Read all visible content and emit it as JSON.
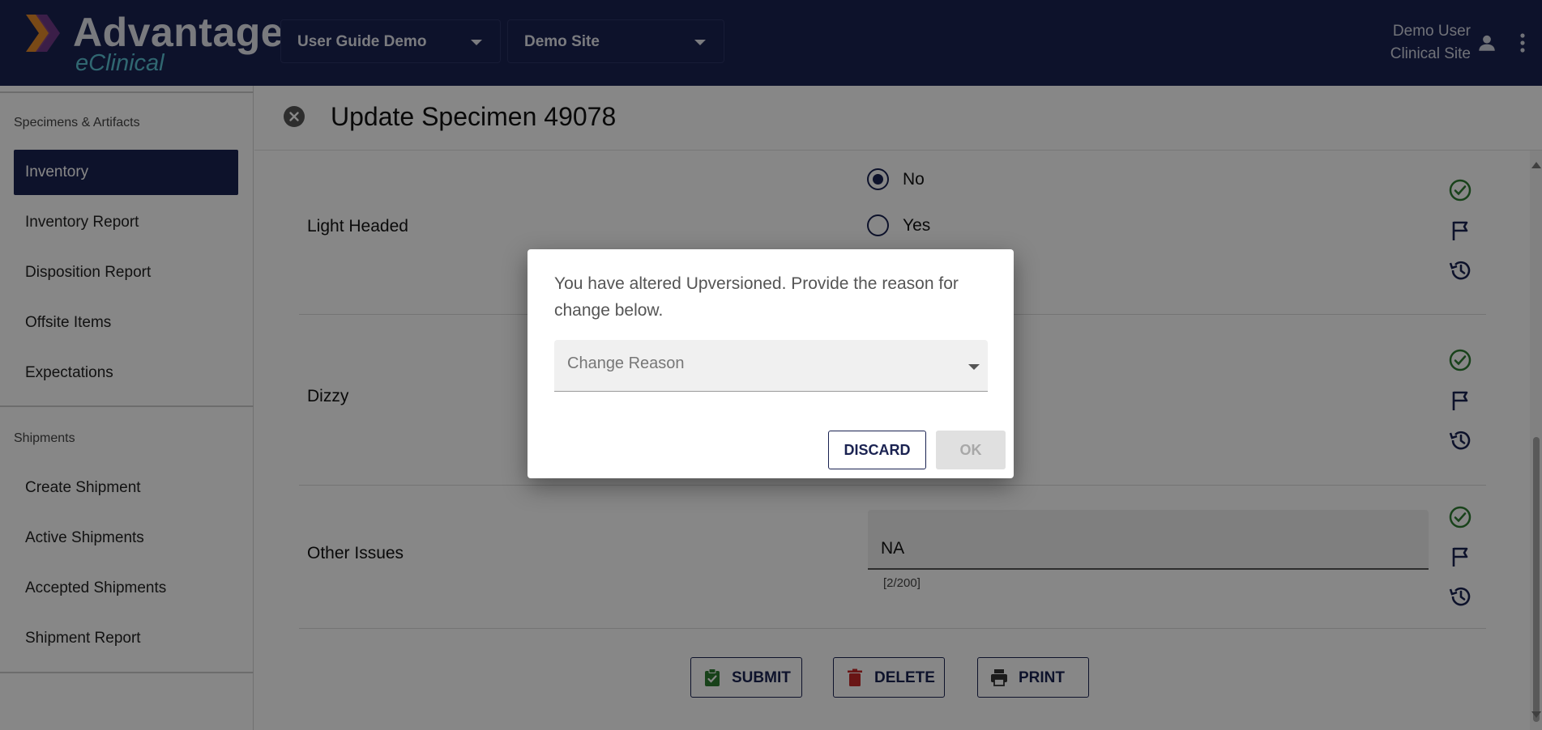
{
  "header": {
    "logo_main": "Advantage",
    "logo_sub": "eClinical",
    "study_select": "User Guide Demo",
    "site_select": "Demo Site",
    "user_name": "Demo User",
    "user_role": "Clinical Site",
    "bg_color": "#1a2251"
  },
  "sidebar": {
    "section1": "Specimens & Artifacts",
    "items1": [
      "Inventory",
      "Inventory Report",
      "Disposition Report",
      "Offsite Items",
      "Expectations"
    ],
    "section2": "Shipments",
    "items2": [
      "Create Shipment",
      "Active Shipments",
      "Accepted Shipments",
      "Shipment Report"
    ],
    "active_item": "Inventory"
  },
  "main": {
    "title": "Update Specimen 49078",
    "rows": [
      {
        "label": "Light Headed",
        "options": [
          "No",
          "Yes"
        ],
        "selected": "No"
      },
      {
        "label": "Dizzy"
      },
      {
        "label": "Other Issues",
        "value": "NA",
        "counter": "[2/200]"
      }
    ],
    "buttons": {
      "submit": "SUBMIT",
      "delete": "DELETE",
      "print": "PRINT"
    }
  },
  "dialog": {
    "message": "You have altered Upversioned. Provide the reason for change below.",
    "select_placeholder": "Change Reason",
    "discard": "DISCARD",
    "ok": "OK"
  },
  "colors": {
    "primary": "#1a2251",
    "success": "#2e7d32",
    "danger": "#c62828",
    "accent": "#5cc2d5"
  }
}
